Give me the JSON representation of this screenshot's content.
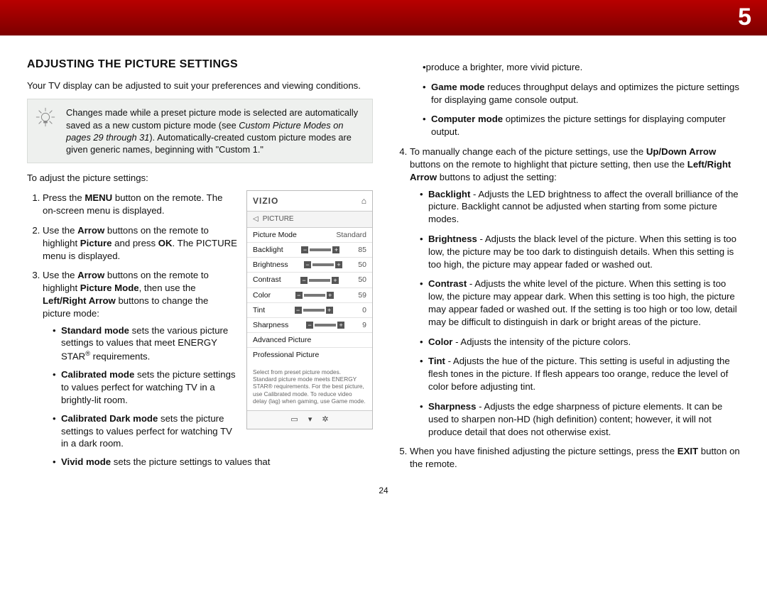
{
  "page": {
    "chapter_number": "5",
    "footer_page": "24"
  },
  "heading": "ADJUSTING THE PICTURE SETTINGS",
  "intro": "Your TV display can be adjusted to suit your preferences and viewing conditions.",
  "tip": {
    "part1": "Changes made while a preset picture mode is selected are automatically saved as a new custom picture mode (see ",
    "italic": "Custom Picture Modes on pages 29 through 31",
    "part2": "). Automatically-created custom picture modes are given generic names, beginning with \"Custom 1.\""
  },
  "lead": "To adjust the picture settings:",
  "step1": {
    "a": "Press the ",
    "b": "MENU",
    "c": " button on the remote. The on-screen menu is displayed."
  },
  "step2": {
    "a": "Use the ",
    "b": "Arrow",
    "c": " buttons on the remote to highlight ",
    "d": "Picture",
    "e": " and press ",
    "f": "OK",
    "g": ". The PICTURE menu is displayed."
  },
  "step3": {
    "a": "Use the ",
    "b": "Arrow",
    "c": " buttons on the remote to highlight ",
    "d": "Picture Mode",
    "e": ", then use the ",
    "f": "Left/Right Arrow",
    "g": " buttons to change the picture mode:"
  },
  "modes": {
    "standard": {
      "label": "Standard mode",
      "text": " sets the various picture settings to values that meet ENERGY STAR",
      "sup": "®",
      "tail": " requirements."
    },
    "calibrated": {
      "label": "Calibrated mode",
      "text": " sets the picture settings to values perfect for watching TV in a brightly-lit room."
    },
    "calibrated_dark": {
      "label": "Calibrated Dark mode",
      "text": " sets the picture settings to values perfect for watching TV in a dark room."
    },
    "vivid": {
      "label": "Vivid mode",
      "text": " sets the picture settings to values that"
    }
  },
  "osd": {
    "logo": "VIZIO",
    "menu_title": "PICTURE",
    "rows": {
      "picture_mode": {
        "label": "Picture Mode",
        "value": "Standard"
      },
      "backlight": {
        "label": "Backlight",
        "value": "85"
      },
      "brightness": {
        "label": "Brightness",
        "value": "50"
      },
      "contrast": {
        "label": "Contrast",
        "value": "50"
      },
      "color": {
        "label": "Color",
        "value": "59"
      },
      "tint": {
        "label": "Tint",
        "value": "0"
      },
      "sharpness": {
        "label": "Sharpness",
        "value": "9"
      },
      "adv": {
        "label": "Advanced Picture"
      },
      "pro": {
        "label": "Professional Picture"
      }
    },
    "note": "Select from preset picture modes. Standard picture mode meets ENERGY STAR® requirements. For the best picture, use Calibrated mode. To reduce video delay (lag) when gaming, use Game mode."
  },
  "col2": {
    "vivid_tail": "produce a brighter, more vivid picture.",
    "game": {
      "label": "Game mode",
      "text": " reduces throughput delays and optimizes the picture settings for displaying game console output."
    },
    "computer": {
      "label": "Computer mode",
      "text": " optimizes the picture settings for displaying computer output."
    },
    "step4": {
      "a": "To manually change each of the picture settings, use the ",
      "b": "Up/Down Arrow",
      "c": " buttons on the remote to highlight that picture setting, then use the ",
      "d": "Left/Right Arrow",
      "e": " buttons to adjust the setting:"
    },
    "settings": {
      "backlight": {
        "label": "Backlight",
        "text": " - Adjusts the LED brightness to affect the overall brilliance of the picture. Backlight cannot be adjusted when starting from some picture modes."
      },
      "brightness": {
        "label": "Brightness",
        "text": " - Adjusts the black level of the picture. When this setting is too low, the picture may be too dark to distinguish details. When this setting is too high, the picture may appear faded or washed out."
      },
      "contrast": {
        "label": "Contrast",
        "text": " - Adjusts the white level of the picture. When this setting is too low, the picture may appear dark. When this setting is too high, the picture may appear faded or washed out. If the setting is too high or too low, detail may be difficult to distinguish in dark or bright areas of the picture."
      },
      "color": {
        "label": "Color",
        "text": " - Adjusts the intensity of the picture colors."
      },
      "tint": {
        "label": "Tint",
        "text": " - Adjusts the hue of the picture. This setting is useful in adjusting the flesh tones in the picture. If flesh appears too orange, reduce the level of color before adjusting tint."
      },
      "sharpness": {
        "label": "Sharpness",
        "text": " - Adjusts the edge sharpness of picture elements. It can be used to sharpen non-HD (high definition) content; however, it will not produce detail that does not otherwise exist."
      }
    },
    "step5": {
      "a": "When you have finished adjusting the picture settings, press the ",
      "b": "EXIT",
      "c": " button on the remote."
    }
  }
}
